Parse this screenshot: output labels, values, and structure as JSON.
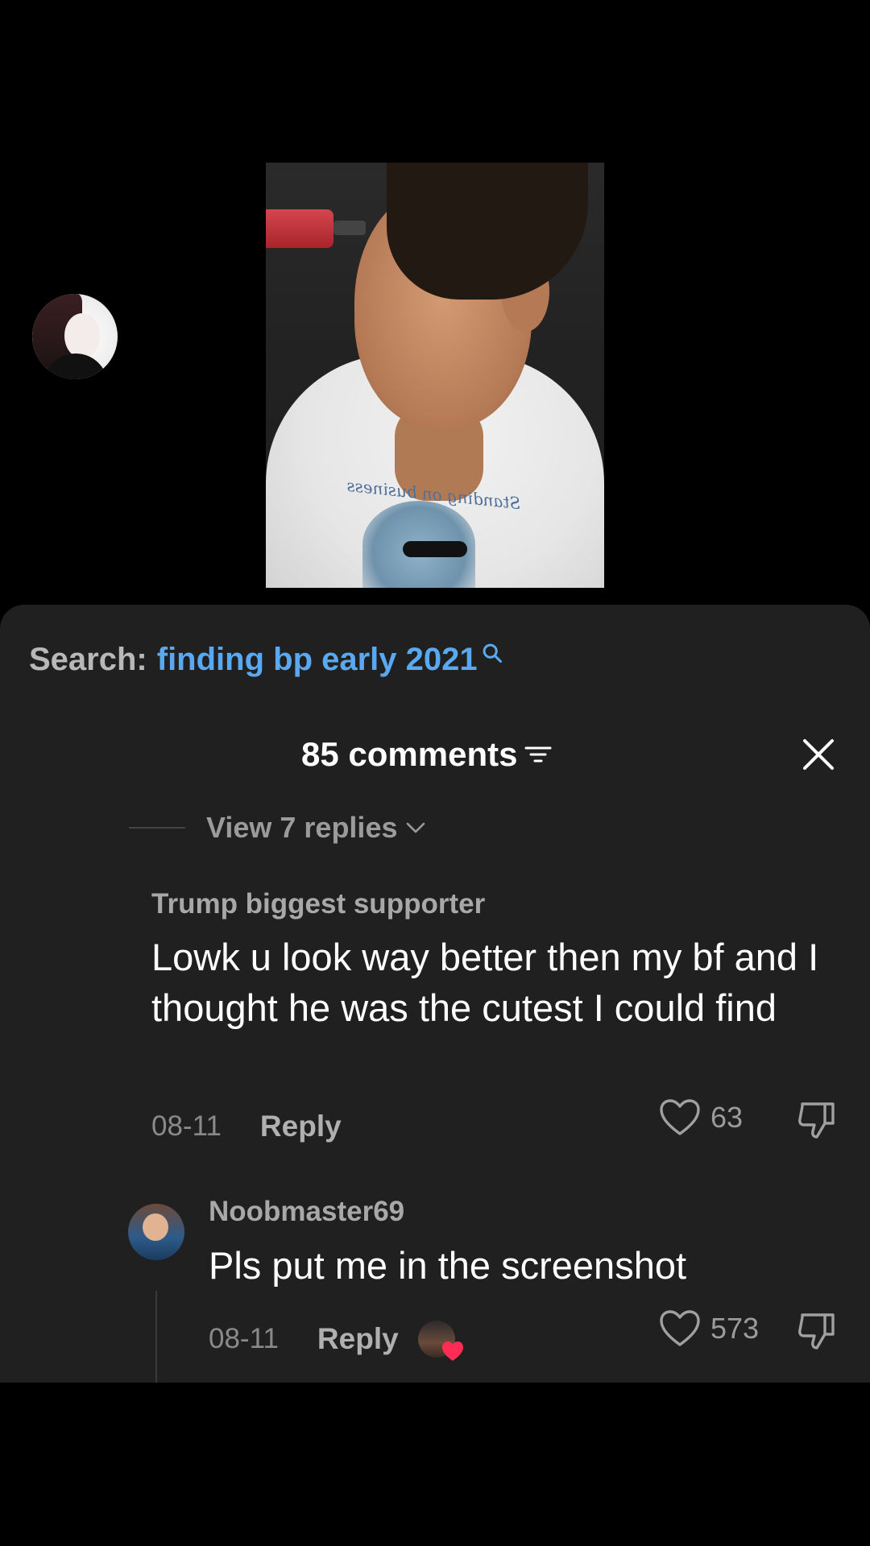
{
  "search": {
    "label": "Search:",
    "query": "finding bp early 2021"
  },
  "header": {
    "comments_count": "85 comments"
  },
  "view_replies": {
    "label": "View 7 replies"
  },
  "comments": [
    {
      "username": "Trump biggest supporter",
      "text": "Lowk u look way better then my bf and I thought he was the cutest I could find",
      "date": "08-11",
      "reply_label": "Reply",
      "likes": "63"
    },
    {
      "username": "Noobmaster69",
      "text": "Pls put me in the screenshot",
      "date": "08-11",
      "reply_label": "Reply",
      "likes": "573"
    }
  ],
  "video": {
    "shirt_text": "Standing on business"
  },
  "colors": {
    "background": "#000000",
    "sheet": "#202020",
    "link": "#5aa8f0",
    "heart": "#ff2d55"
  }
}
